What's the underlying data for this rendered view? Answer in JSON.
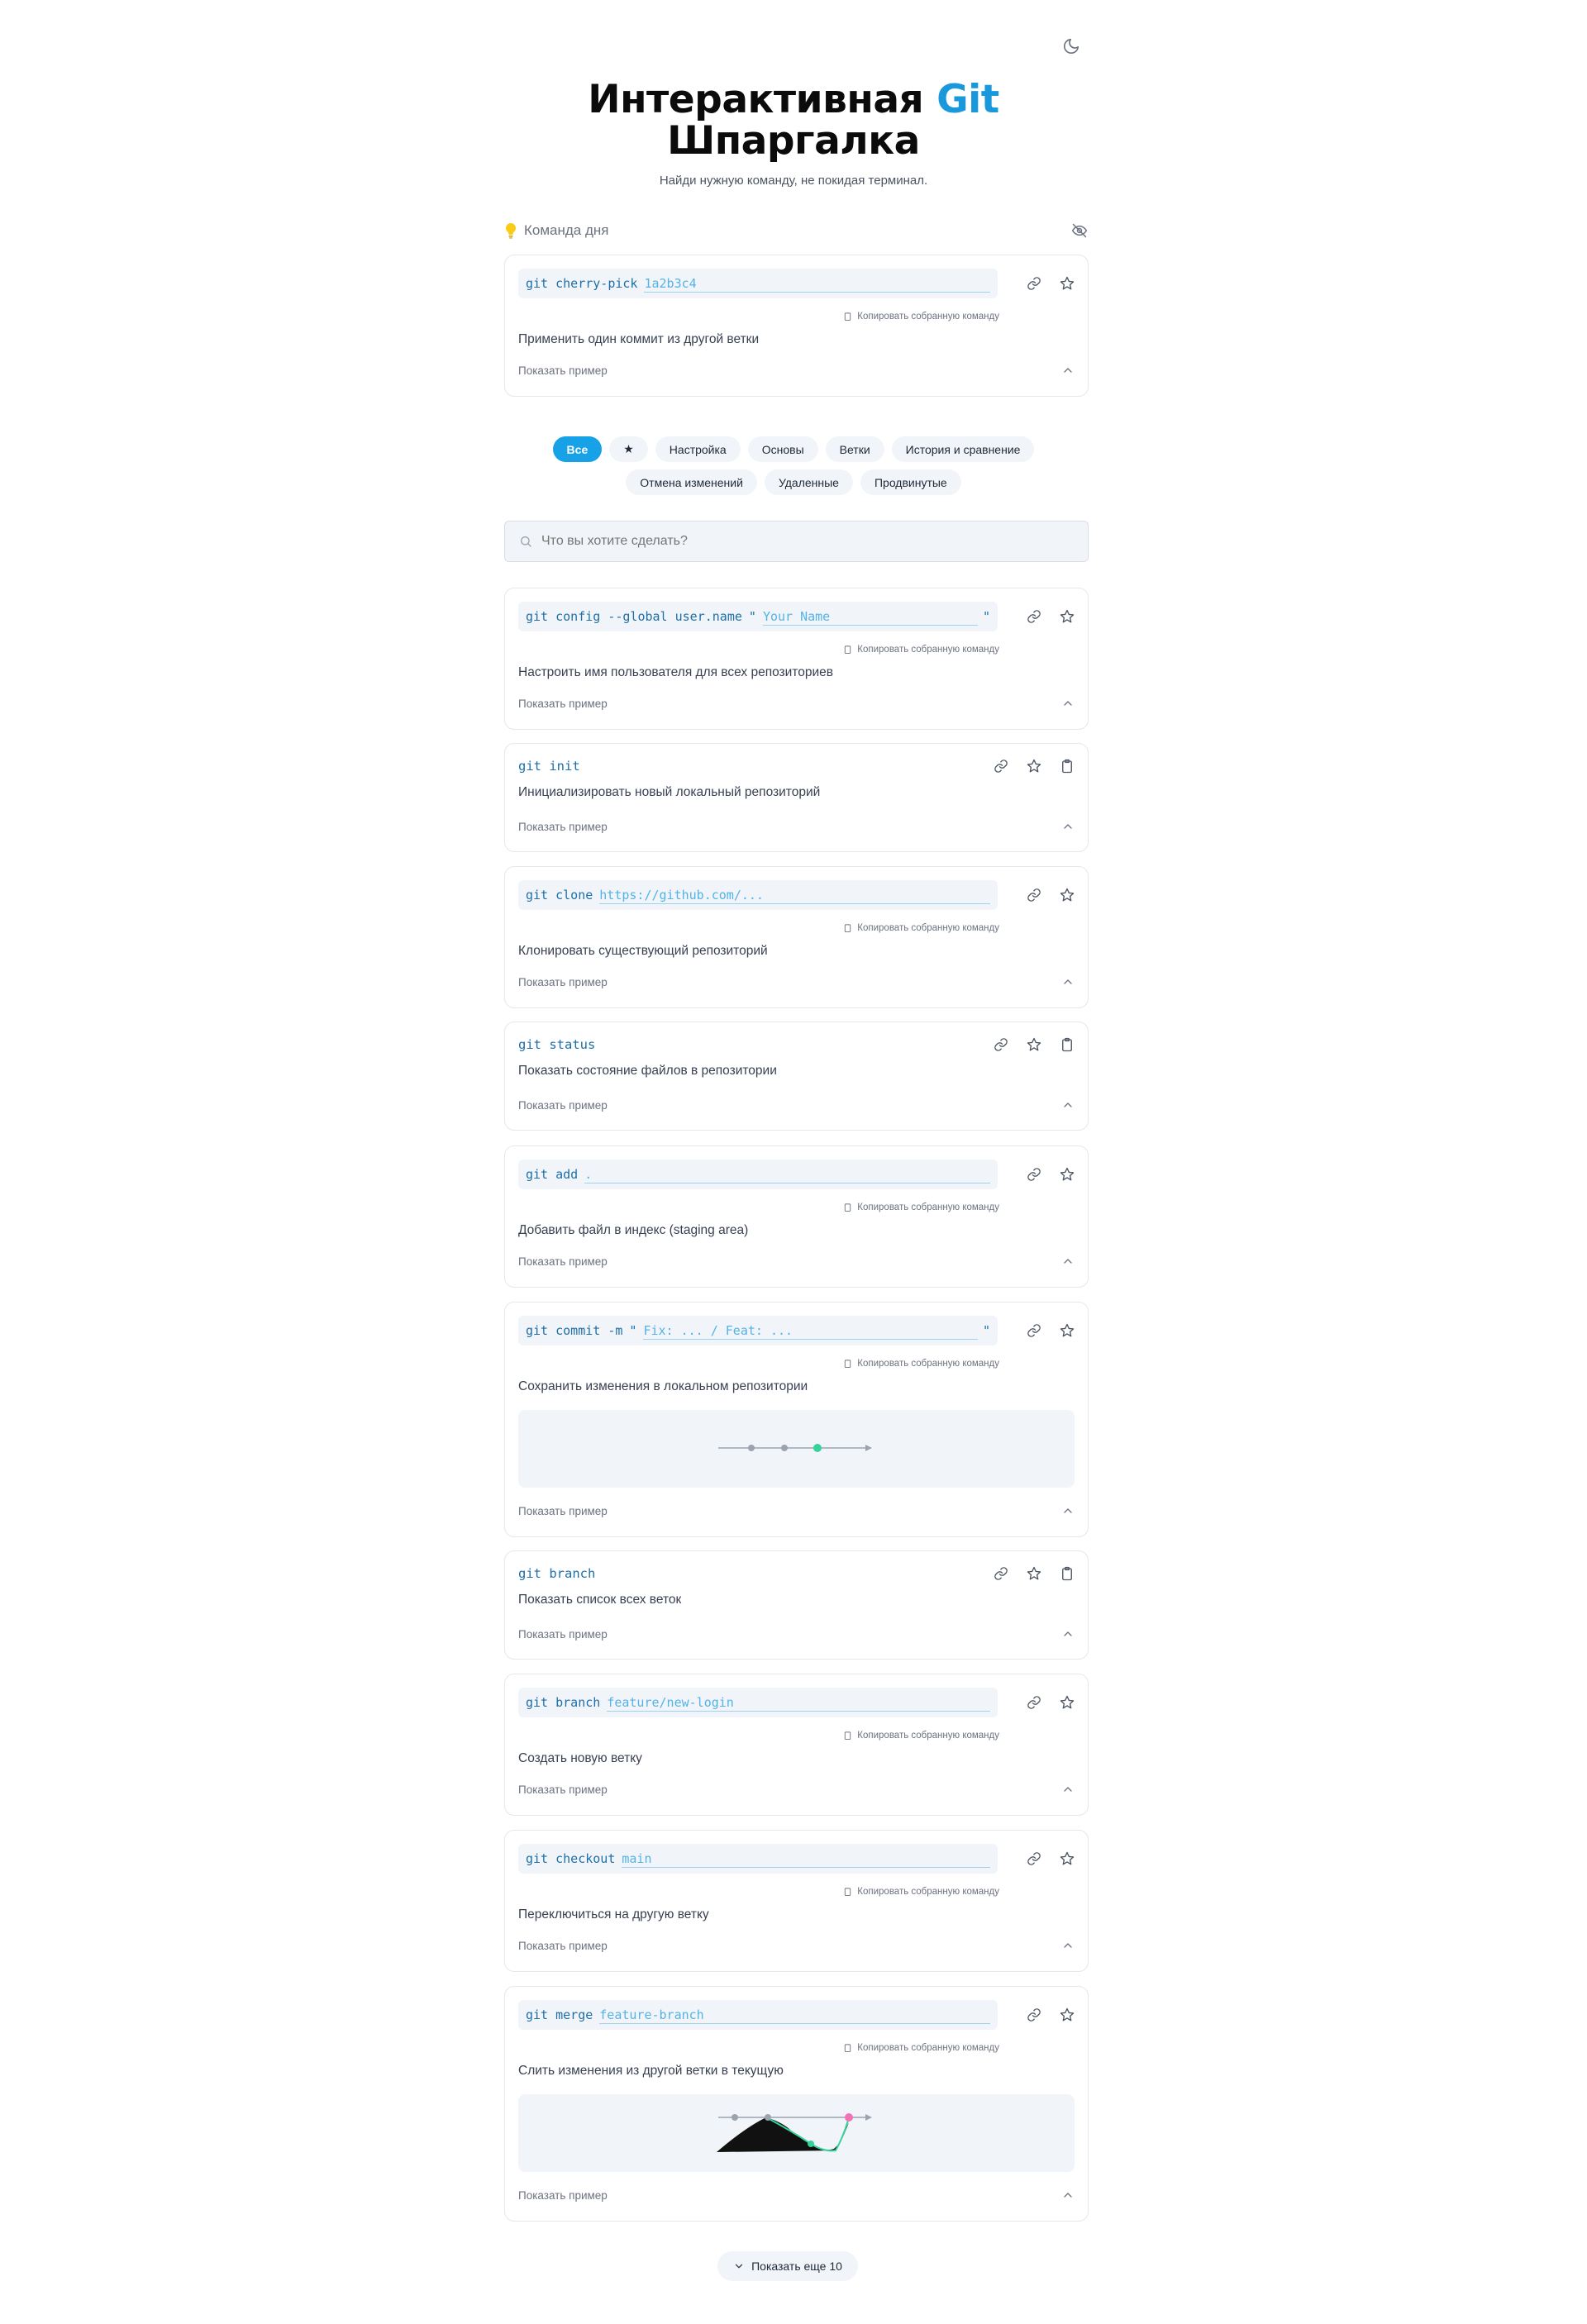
{
  "header": {
    "title_part1": "Интерактивная",
    "title_accent": "Git",
    "title_part2": "Шпаргалка",
    "subtitle": "Найди нужную команду, не покидая терминал."
  },
  "command_of_day": {
    "label": "Команда дня",
    "command": "git cherry-pick",
    "param": "1a2b3c4",
    "copy_label": "Копировать собранную команду",
    "description": "Применить один коммит из другой ветки",
    "example_label": "Показать пример"
  },
  "filters": {
    "row1": [
      "Все",
      "★",
      "Настройка",
      "Основы",
      "Ветки",
      "История и сравнение"
    ],
    "row2": [
      "Отмена изменений",
      "Удаленные",
      "Продвинутые"
    ]
  },
  "search": {
    "placeholder": "Что вы хотите сделать?"
  },
  "commands": [
    {
      "command": "git config --global user.name",
      "param": "Your Name",
      "quoted": true,
      "copy_label": "Копировать собранную команду",
      "description": "Настроить имя пользователя для всех репозиториев",
      "example_label": "Показать пример"
    },
    {
      "command": "git init",
      "description": "Инициализировать новый локальный репозиторий",
      "example_label": "Показать пример"
    },
    {
      "command": "git clone",
      "param": "https://github.com/...",
      "copy_label": "Копировать собранную команду",
      "description": "Клонировать существующий репозиторий",
      "example_label": "Показать пример"
    },
    {
      "command": "git status",
      "description": "Показать состояние файлов в репозитории",
      "example_label": "Показать пример"
    },
    {
      "command": "git add",
      "param": ".",
      "copy_label": "Копировать собранную команду",
      "description": "Добавить файл в индекс (staging area)",
      "example_label": "Показать пример"
    },
    {
      "command": "git commit -m",
      "param": "Fix: ... / Feat: ...",
      "quoted": true,
      "copy_label": "Копировать собранную команду",
      "description": "Сохранить изменения в локальном репозитории",
      "example_label": "Показать пример"
    },
    {
      "command": "git branch",
      "description": "Показать список всех веток",
      "example_label": "Показать пример"
    },
    {
      "command": "git branch",
      "param": "feature/new-login",
      "copy_label": "Копировать собранную команду",
      "description": "Создать новую ветку",
      "example_label": "Показать пример"
    },
    {
      "command": "git checkout",
      "param": "main",
      "copy_label": "Копировать собранную команду",
      "description": "Переключиться на другую ветку",
      "example_label": "Показать пример"
    },
    {
      "command": "git merge",
      "param": "feature-branch",
      "copy_label": "Копировать собранную команду",
      "description": "Слить изменения из другой ветки в текущую",
      "example_label": "Показать пример"
    }
  ],
  "quote_char": "\"",
  "show_more": {
    "label": "Показать еще 10"
  },
  "colors": {
    "accent": "#17a1e6",
    "param": "#53b3e6",
    "command": "#1e6fa8",
    "commit_new": "#34d399",
    "merge_node": "#f472b6",
    "bulb": "#facc15"
  },
  "icons": [
    "moon-icon",
    "bulb-icon",
    "eye-off-icon",
    "link-icon",
    "star-icon",
    "clipboard-icon",
    "chevron-up-icon",
    "chevron-down-icon",
    "search-icon"
  ]
}
